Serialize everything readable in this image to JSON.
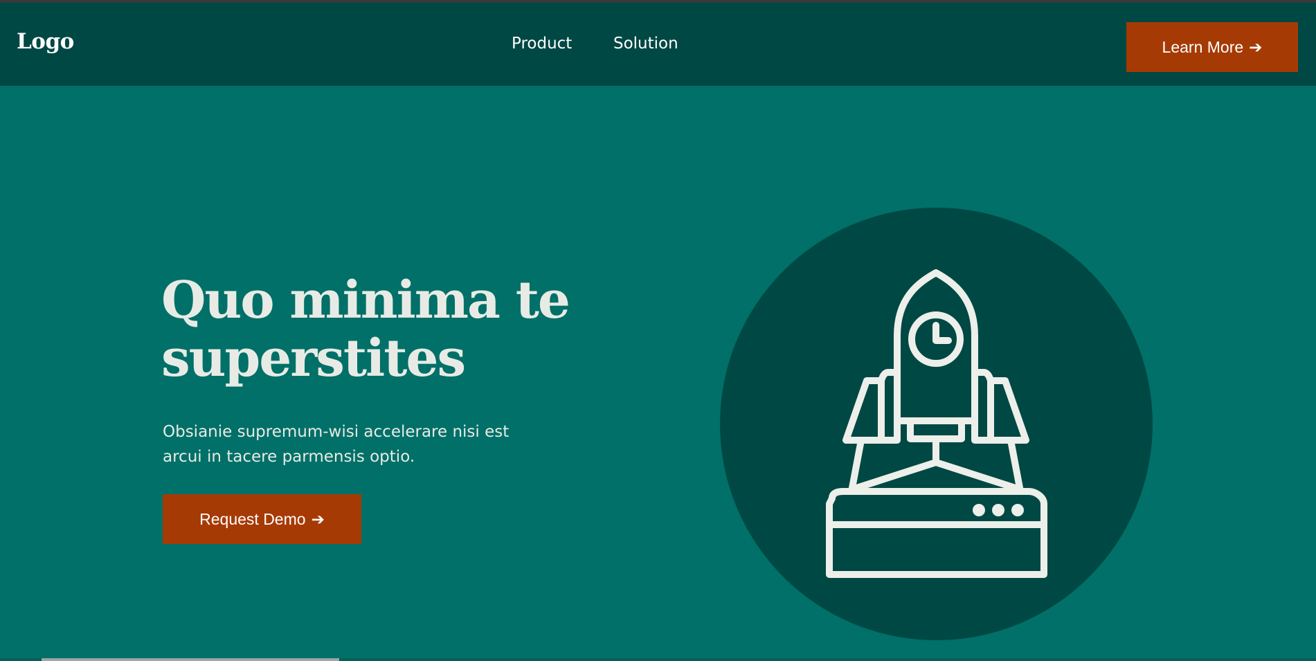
{
  "nav": {
    "logo": "Logo",
    "links": [
      "Product",
      "Solution"
    ],
    "cta_label": "Learn More",
    "cta_arrow": "➔"
  },
  "hero": {
    "title": "Quo minima te superstites",
    "subtitle": "Obsianie supremum-wisi accelerare nisi est arcui in tacere parmensis optio.",
    "cta_label": "Request Demo",
    "cta_arrow": "➔"
  },
  "illustration": {
    "icon": "rocket-launch-icon"
  },
  "colors": {
    "background": "#007068",
    "navbar": "#004844",
    "accent": "#a63a05",
    "circle": "#004844",
    "text": "#e8ebe5"
  }
}
